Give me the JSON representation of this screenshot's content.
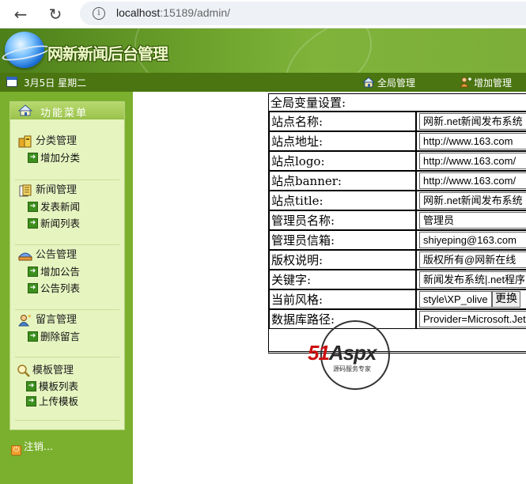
{
  "browser": {
    "back_icon": "arrow-left-icon",
    "reload_icon": "reload-icon",
    "info_icon": "info-icon",
    "url_host": "localhost",
    "url_rest": ":15189/admin/"
  },
  "header": {
    "logo_text": "网新新闻后台管理",
    "date": "3月5日 星期二",
    "nav": [
      {
        "label": "全局管理",
        "icon": "house-icon"
      },
      {
        "label": "增加管理",
        "icon": "user-add-icon"
      }
    ]
  },
  "sidebar": {
    "title": "功能菜单",
    "groups": [
      {
        "title": "分类管理",
        "icon": "category-icon",
        "items": [
          "增加分类"
        ]
      },
      {
        "title": "新闻管理",
        "icon": "news-icon",
        "items": [
          "发表新闻",
          "新闻列表"
        ]
      },
      {
        "title": "公告管理",
        "icon": "notice-icon",
        "items": [
          "增加公告",
          "公告列表"
        ]
      },
      {
        "title": "留言管理",
        "icon": "message-icon",
        "items": [
          "删除留言"
        ]
      },
      {
        "title": "模板管理",
        "icon": "template-icon",
        "items": [
          "模板列表",
          "上传模板"
        ]
      }
    ],
    "logout": "注销..."
  },
  "settings": {
    "heading": "全局变量设置:",
    "rows": [
      {
        "label": "站点名称:",
        "value": "网新.net新闻发布系统"
      },
      {
        "label": "站点地址:",
        "value": "http://www.163.com"
      },
      {
        "label": "站点logo:",
        "value": "http://www.163.com/"
      },
      {
        "label": "站点banner:",
        "value": "http://www.163.com/"
      },
      {
        "label": "站点title:",
        "value": "网新.net新闻发布系统"
      },
      {
        "label": "管理员名称:",
        "value": "管理员"
      },
      {
        "label": "管理员信箱:",
        "value": "shiyeping@163.com"
      },
      {
        "label": "版权说明:",
        "value": "版权所有@网新在线"
      },
      {
        "label": "关键字:",
        "value": "新闻发布系统|.net程序"
      },
      {
        "label": "当前风格:",
        "value": "style\\XP_olive",
        "button": "更换"
      },
      {
        "label": "数据库路径:",
        "value": "Provider=Microsoft.Jet"
      }
    ]
  },
  "watermark": {
    "brand_red": "51",
    "brand_dark": "Aspx",
    "tagline": "源码服务专家"
  },
  "colors": {
    "sidebar_green": "#7ab02e",
    "topbar_green": "#4a7510",
    "panel_bg": "#e6f4c0"
  }
}
